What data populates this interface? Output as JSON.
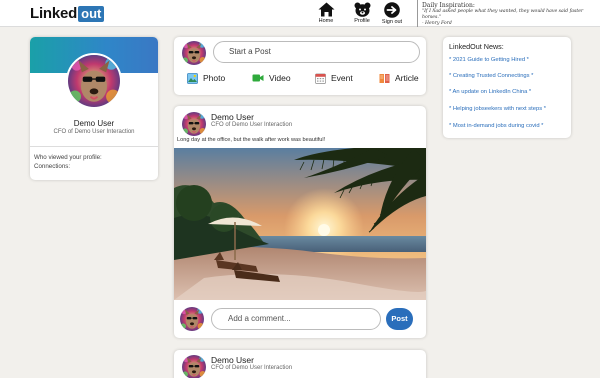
{
  "header": {
    "logo_part1": "Linked",
    "logo_part2": "out",
    "nav": {
      "home_label": "Home",
      "profile_label": "Profile",
      "signout_label": "Sign out"
    },
    "inspiration": {
      "title": "Daily Inspiration:",
      "quote": "\"If I had asked people what they wanted, they would have said faster horses.\"",
      "author": "- Henry Ford"
    }
  },
  "profile": {
    "name": "Demo User",
    "title": "CFO of Demo User Interaction",
    "views_label": "Who viewed your profile:",
    "connections_label": "Connections:"
  },
  "create_post": {
    "placeholder": "Start a Post",
    "actions": {
      "photo": "Photo",
      "video": "Video",
      "event": "Event",
      "article": "Article"
    }
  },
  "posts": [
    {
      "author": "Demo User",
      "subtitle": "CFO of Demo User Interaction",
      "text": "Long day at the office, but the walk after work was beautiful!",
      "comment_placeholder": "Add a comment...",
      "post_button": "Post"
    },
    {
      "author": "Demo User",
      "subtitle": "CFO of Demo User Interaction"
    }
  ],
  "news": {
    "title": "LinkedOut News:",
    "items": [
      "* 2021 Guide to Getting Hired *",
      "* Creating Trusted Connectings *",
      "* An update on LinkedIn China *",
      "* Helping jobseekers with next steps *",
      "* Most in-demand jobs during covid *"
    ]
  },
  "colors": {
    "accent": "#2a6ebb",
    "page_background": "#f2f0ec",
    "banner_start": "#1aa0a8",
    "banner_end": "#3a78c4"
  },
  "icons": {
    "home": "home-icon",
    "profile": "bear-icon",
    "signout": "signout-arrow-icon",
    "photo": "photo-icon",
    "video": "video-camera-icon",
    "event": "calendar-icon",
    "article": "article-icon"
  }
}
